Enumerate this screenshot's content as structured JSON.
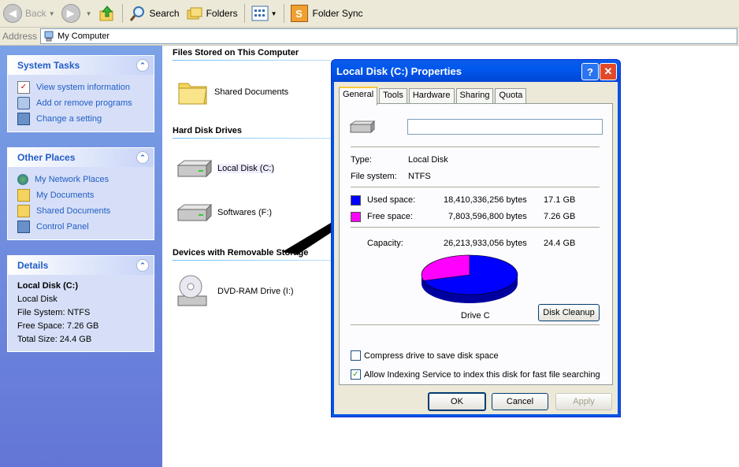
{
  "toolbar": {
    "back_label": "Back",
    "search_label": "Search",
    "folders_label": "Folders",
    "folder_sync_label": "Folder Sync"
  },
  "address": {
    "label": "Address",
    "value": "My Computer"
  },
  "system_tasks": {
    "title": "System Tasks",
    "items": [
      "View system information",
      "Add or remove programs",
      "Change a setting"
    ]
  },
  "other_places": {
    "title": "Other Places",
    "items": [
      "My Network Places",
      "My Documents",
      "Shared Documents",
      "Control Panel"
    ]
  },
  "details": {
    "title": "Details",
    "name": "Local Disk (C:)",
    "type": "Local Disk",
    "file_system": "File System: NTFS",
    "free_space": "Free Space: 7.26 GB",
    "total_size": "Total Size: 24.4 GB"
  },
  "main": {
    "files_stored_header": "Files Stored on This Computer",
    "shared_documents": "Shared Documents",
    "hard_disk_header": "Hard Disk Drives",
    "local_disk": "Local Disk (C:)",
    "softwares": "Softwares (F:)",
    "removable_header": "Devices with Removable Storage",
    "dvd_drive": "DVD-RAM Drive (I:)"
  },
  "dialog": {
    "title": "Local Disk (C:) Properties",
    "tabs": [
      "General",
      "Tools",
      "Hardware",
      "Sharing",
      "Quota"
    ],
    "label_value": "",
    "type_label": "Type:",
    "type_value": "Local Disk",
    "fs_label": "File system:",
    "fs_value": "NTFS",
    "used_label": "Used space:",
    "used_bytes": "18,410,336,256 bytes",
    "used_gb": "17.1 GB",
    "free_label": "Free space:",
    "free_bytes": "7,803,596,800 bytes",
    "free_gb": "7.26 GB",
    "capacity_label": "Capacity:",
    "capacity_bytes": "26,213,933,056 bytes",
    "capacity_gb": "24.4 GB",
    "drive_label": "Drive C",
    "disk_cleanup": "Disk Cleanup",
    "compress_label": "Compress drive to save disk space",
    "compress_checked": false,
    "index_label": "Allow Indexing Service to index this disk for fast file searching",
    "index_checked": true,
    "ok": "OK",
    "cancel": "Cancel",
    "apply": "Apply",
    "used_fraction": 0.702,
    "used_color": "#0000ff",
    "free_color": "#ff00ff"
  }
}
